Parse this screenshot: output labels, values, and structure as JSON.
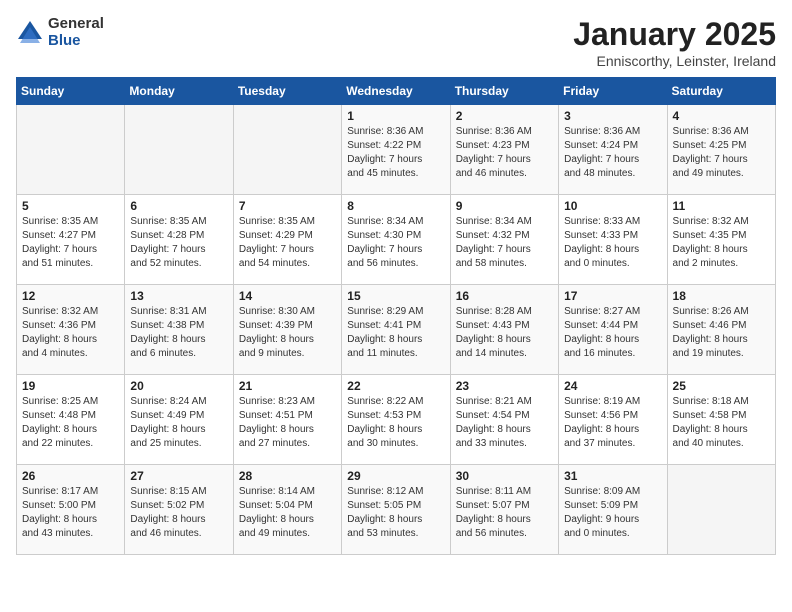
{
  "logo": {
    "general": "General",
    "blue": "Blue"
  },
  "header": {
    "title": "January 2025",
    "subtitle": "Enniscorthy, Leinster, Ireland"
  },
  "weekdays": [
    "Sunday",
    "Monday",
    "Tuesday",
    "Wednesday",
    "Thursday",
    "Friday",
    "Saturday"
  ],
  "weeks": [
    [
      {
        "day": "",
        "info": ""
      },
      {
        "day": "",
        "info": ""
      },
      {
        "day": "",
        "info": ""
      },
      {
        "day": "1",
        "info": "Sunrise: 8:36 AM\nSunset: 4:22 PM\nDaylight: 7 hours\nand 45 minutes."
      },
      {
        "day": "2",
        "info": "Sunrise: 8:36 AM\nSunset: 4:23 PM\nDaylight: 7 hours\nand 46 minutes."
      },
      {
        "day": "3",
        "info": "Sunrise: 8:36 AM\nSunset: 4:24 PM\nDaylight: 7 hours\nand 48 minutes."
      },
      {
        "day": "4",
        "info": "Sunrise: 8:36 AM\nSunset: 4:25 PM\nDaylight: 7 hours\nand 49 minutes."
      }
    ],
    [
      {
        "day": "5",
        "info": "Sunrise: 8:35 AM\nSunset: 4:27 PM\nDaylight: 7 hours\nand 51 minutes."
      },
      {
        "day": "6",
        "info": "Sunrise: 8:35 AM\nSunset: 4:28 PM\nDaylight: 7 hours\nand 52 minutes."
      },
      {
        "day": "7",
        "info": "Sunrise: 8:35 AM\nSunset: 4:29 PM\nDaylight: 7 hours\nand 54 minutes."
      },
      {
        "day": "8",
        "info": "Sunrise: 8:34 AM\nSunset: 4:30 PM\nDaylight: 7 hours\nand 56 minutes."
      },
      {
        "day": "9",
        "info": "Sunrise: 8:34 AM\nSunset: 4:32 PM\nDaylight: 7 hours\nand 58 minutes."
      },
      {
        "day": "10",
        "info": "Sunrise: 8:33 AM\nSunset: 4:33 PM\nDaylight: 8 hours\nand 0 minutes."
      },
      {
        "day": "11",
        "info": "Sunrise: 8:32 AM\nSunset: 4:35 PM\nDaylight: 8 hours\nand 2 minutes."
      }
    ],
    [
      {
        "day": "12",
        "info": "Sunrise: 8:32 AM\nSunset: 4:36 PM\nDaylight: 8 hours\nand 4 minutes."
      },
      {
        "day": "13",
        "info": "Sunrise: 8:31 AM\nSunset: 4:38 PM\nDaylight: 8 hours\nand 6 minutes."
      },
      {
        "day": "14",
        "info": "Sunrise: 8:30 AM\nSunset: 4:39 PM\nDaylight: 8 hours\nand 9 minutes."
      },
      {
        "day": "15",
        "info": "Sunrise: 8:29 AM\nSunset: 4:41 PM\nDaylight: 8 hours\nand 11 minutes."
      },
      {
        "day": "16",
        "info": "Sunrise: 8:28 AM\nSunset: 4:43 PM\nDaylight: 8 hours\nand 14 minutes."
      },
      {
        "day": "17",
        "info": "Sunrise: 8:27 AM\nSunset: 4:44 PM\nDaylight: 8 hours\nand 16 minutes."
      },
      {
        "day": "18",
        "info": "Sunrise: 8:26 AM\nSunset: 4:46 PM\nDaylight: 8 hours\nand 19 minutes."
      }
    ],
    [
      {
        "day": "19",
        "info": "Sunrise: 8:25 AM\nSunset: 4:48 PM\nDaylight: 8 hours\nand 22 minutes."
      },
      {
        "day": "20",
        "info": "Sunrise: 8:24 AM\nSunset: 4:49 PM\nDaylight: 8 hours\nand 25 minutes."
      },
      {
        "day": "21",
        "info": "Sunrise: 8:23 AM\nSunset: 4:51 PM\nDaylight: 8 hours\nand 27 minutes."
      },
      {
        "day": "22",
        "info": "Sunrise: 8:22 AM\nSunset: 4:53 PM\nDaylight: 8 hours\nand 30 minutes."
      },
      {
        "day": "23",
        "info": "Sunrise: 8:21 AM\nSunset: 4:54 PM\nDaylight: 8 hours\nand 33 minutes."
      },
      {
        "day": "24",
        "info": "Sunrise: 8:19 AM\nSunset: 4:56 PM\nDaylight: 8 hours\nand 37 minutes."
      },
      {
        "day": "25",
        "info": "Sunrise: 8:18 AM\nSunset: 4:58 PM\nDaylight: 8 hours\nand 40 minutes."
      }
    ],
    [
      {
        "day": "26",
        "info": "Sunrise: 8:17 AM\nSunset: 5:00 PM\nDaylight: 8 hours\nand 43 minutes."
      },
      {
        "day": "27",
        "info": "Sunrise: 8:15 AM\nSunset: 5:02 PM\nDaylight: 8 hours\nand 46 minutes."
      },
      {
        "day": "28",
        "info": "Sunrise: 8:14 AM\nSunset: 5:04 PM\nDaylight: 8 hours\nand 49 minutes."
      },
      {
        "day": "29",
        "info": "Sunrise: 8:12 AM\nSunset: 5:05 PM\nDaylight: 8 hours\nand 53 minutes."
      },
      {
        "day": "30",
        "info": "Sunrise: 8:11 AM\nSunset: 5:07 PM\nDaylight: 8 hours\nand 56 minutes."
      },
      {
        "day": "31",
        "info": "Sunrise: 8:09 AM\nSunset: 5:09 PM\nDaylight: 9 hours\nand 0 minutes."
      },
      {
        "day": "",
        "info": ""
      }
    ]
  ]
}
